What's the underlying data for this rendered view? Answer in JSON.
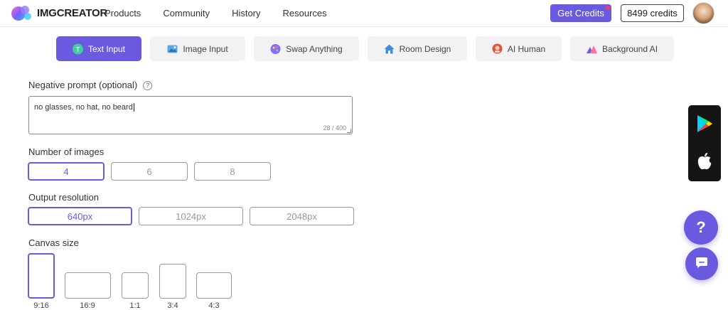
{
  "header": {
    "logo_text": "IMGCREATOR",
    "nav": [
      "Products",
      "Community",
      "History",
      "Resources"
    ],
    "get_credits": "Get Credits",
    "credits": "8499 credits"
  },
  "tabs": [
    {
      "label": "Text Input",
      "icon": "text-input-icon",
      "active": true
    },
    {
      "label": "Image Input",
      "icon": "image-input-icon"
    },
    {
      "label": "Swap Anything",
      "icon": "swap-anything-icon"
    },
    {
      "label": "Room Design",
      "icon": "home-icon"
    },
    {
      "label": "AI Human",
      "icon": "ai-human-icon"
    },
    {
      "label": "Background AI",
      "icon": "background-ai-icon"
    }
  ],
  "form": {
    "negative_prompt": {
      "label": "Negative prompt (optional)",
      "help": "?",
      "value": "no glasses, no hat, no beard",
      "counter": "28 / 400"
    },
    "num_images": {
      "label": "Number of images",
      "options": [
        "4",
        "6",
        "8"
      ],
      "selected": "4"
    },
    "resolution": {
      "label": "Output resolution",
      "options": [
        "640px",
        "1024px",
        "2048px"
      ],
      "selected": "640px"
    },
    "canvas": {
      "label": "Canvas size",
      "options": [
        "9:16",
        "16:9",
        "1:1",
        "3:4",
        "4:3"
      ],
      "selected": "9:16"
    }
  },
  "floating": {
    "help": "?",
    "icons": [
      "google-play-icon",
      "apple-icon",
      "help-icon",
      "chat-icon"
    ]
  },
  "colors": {
    "accent": "#6a5ae0",
    "dark": "#151516",
    "badge": "#ff3b4e"
  }
}
